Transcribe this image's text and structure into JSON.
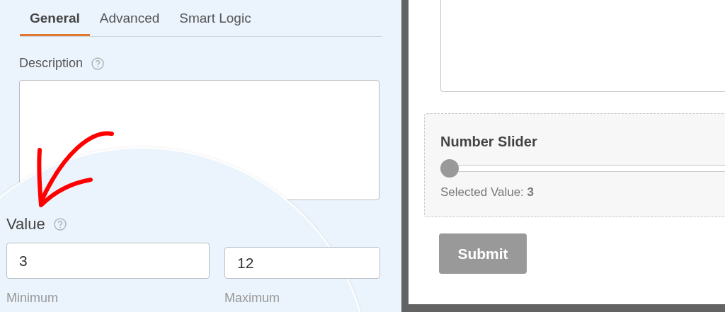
{
  "settings_panel": {
    "tabs": [
      {
        "label": "General",
        "selected": true
      },
      {
        "label": "Advanced",
        "selected": false
      },
      {
        "label": "Smart Logic",
        "selected": false
      }
    ],
    "description": {
      "label": "Description"
    },
    "value": {
      "label": "Value",
      "minimum": {
        "value": "3",
        "sublabel": "Minimum"
      },
      "maximum": {
        "value": "12",
        "sublabel": "Maximum"
      }
    }
  },
  "preview": {
    "field_label": "Number Slider",
    "slider": {
      "level": 0
    },
    "selected_value": "Selected Value: **3**",
    "submit": "Submit"
  }
}
